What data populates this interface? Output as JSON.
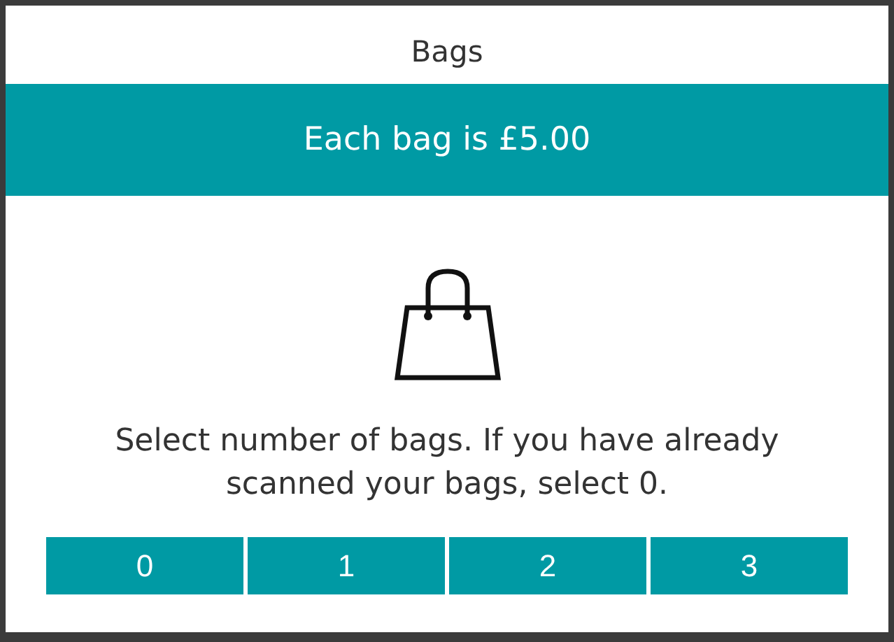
{
  "dialog": {
    "title": "Bags",
    "banner": "Each bag is £5.00",
    "message": "Select number of bags. If you have already scanned your bags, select 0.",
    "options": [
      {
        "label": "0"
      },
      {
        "label": "1"
      },
      {
        "label": "2"
      },
      {
        "label": "3"
      }
    ]
  }
}
